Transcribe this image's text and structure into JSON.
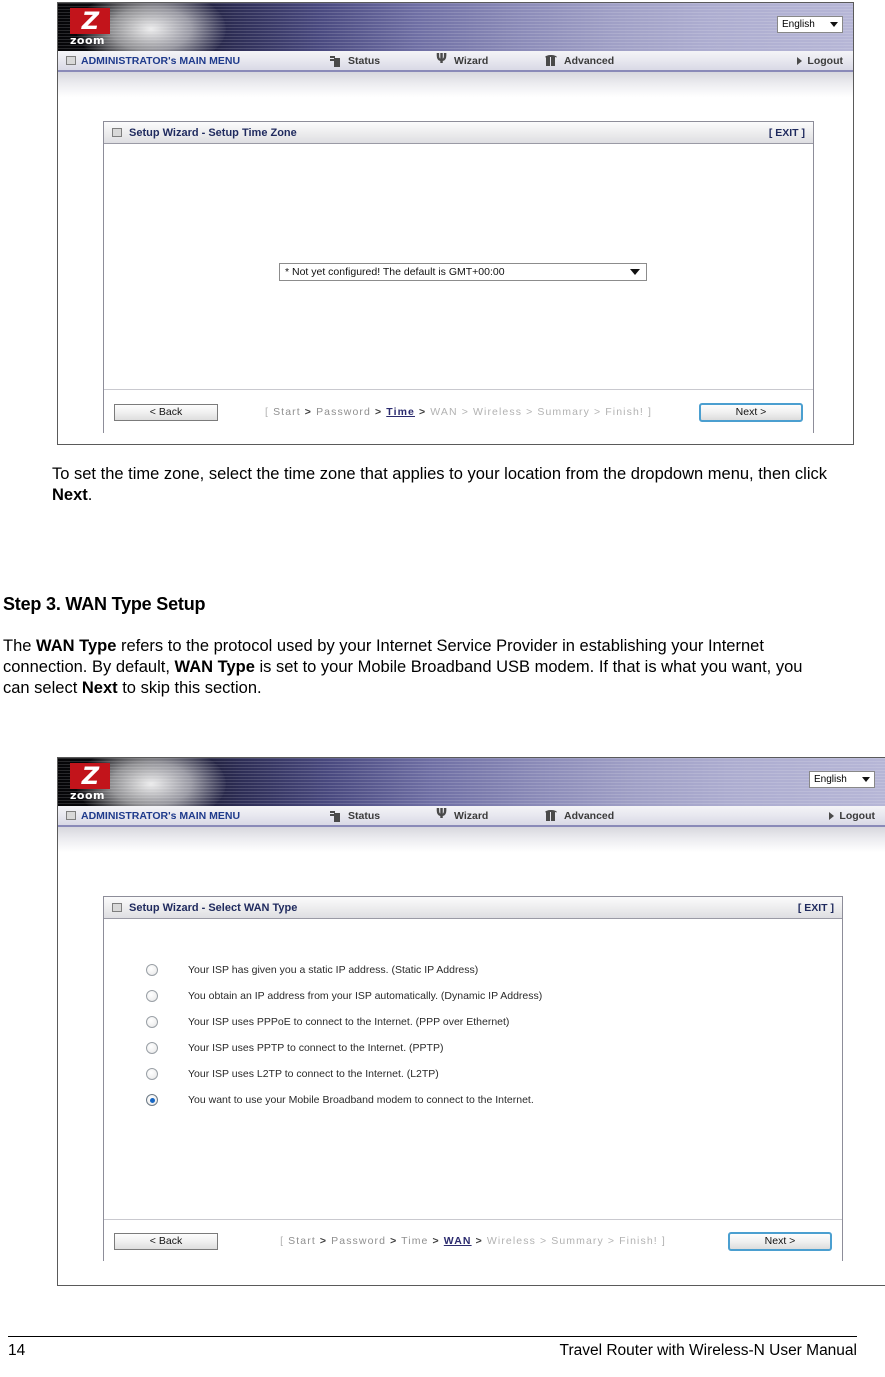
{
  "router_ui": {
    "language_selector": {
      "value": "English",
      "caret_icon": "chevron-down-icon"
    },
    "logo": {
      "letter": "Z",
      "word": "zoom"
    },
    "nav": {
      "main_menu": "ADMINISTRATOR's MAIN MENU",
      "status": "Status",
      "wizard": "Wizard",
      "advanced": "Advanced",
      "logout": "Logout"
    }
  },
  "screenshot_timezone": {
    "panel_title": "Setup Wizard - Setup Time Zone",
    "exit_label": "[ EXIT ]",
    "timezone_select": {
      "value": "* Not yet configured! The default is GMT+00:00",
      "caret_icon": "chevron-down-icon"
    },
    "back_label": "< Back",
    "next_label": "Next >",
    "breadcrumb": {
      "open": "[",
      "steps": [
        "Start",
        "Password",
        "Time",
        "WAN",
        "Wireless",
        "Summary",
        "Finish!"
      ],
      "active": "Time",
      "close": "]"
    }
  },
  "screenshot_wantype": {
    "panel_title": "Setup Wizard - Select WAN Type",
    "exit_label": "[ EXIT ]",
    "options": [
      {
        "label": "Your ISP has given you a static IP address. (Static IP Address)",
        "selected": false
      },
      {
        "label": "You obtain an IP address from your ISP automatically. (Dynamic IP Address)",
        "selected": false
      },
      {
        "label": "Your ISP uses PPPoE to connect to the Internet. (PPP over Ethernet)",
        "selected": false
      },
      {
        "label": "Your ISP uses PPTP to connect to the Internet. (PPTP)",
        "selected": false
      },
      {
        "label": "Your ISP uses L2TP to connect to the Internet. (L2TP)",
        "selected": false
      },
      {
        "label": "You want to use your Mobile Broadband modem to connect to the Internet.",
        "selected": true
      }
    ],
    "back_label": "< Back",
    "next_label": "Next >",
    "breadcrumb": {
      "open": "[",
      "steps": [
        "Start",
        "Password",
        "Time",
        "WAN",
        "Wireless",
        "Summary",
        "Finish!"
      ],
      "active": "WAN",
      "close": "]"
    }
  },
  "document": {
    "paragraph_timezone_pre": "To set the time zone, select the time zone that applies to your location from the dropdown menu, then click ",
    "paragraph_timezone_bold": "Next",
    "paragraph_timezone_post": ".",
    "heading_step3": "Step 3. WAN Type Setup",
    "paragraph_wan_1": "The ",
    "paragraph_wan_b1": "WAN Type",
    "paragraph_wan_2": " refers to the protocol used by your Internet Service Provider in establishing your Internet connection. By default, ",
    "paragraph_wan_b2": "WAN Type",
    "paragraph_wan_3": " is set to your Mobile Broadband USB modem. If that is what you want, you can select ",
    "paragraph_wan_b3": "Next",
    "paragraph_wan_4": " to skip this section.",
    "footer_page_number": "14",
    "footer_title": "Travel Router with Wireless-N User Manual"
  }
}
